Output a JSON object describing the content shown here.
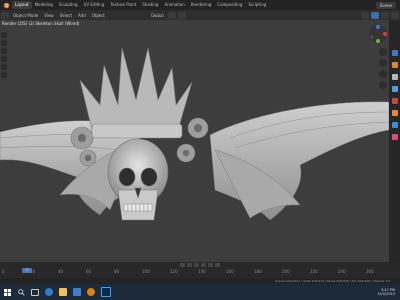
{
  "app": {
    "title_overlay": "Render (Z/S) (2) Skeleton Skull (Wired)",
    "workspace_tabs": [
      "Layout",
      "Modeling",
      "Sculpting",
      "UV Editing",
      "Texture Paint",
      "Shading",
      "Animation",
      "Rendering",
      "Compositing",
      "Scripting"
    ],
    "active_tab": "Layout",
    "scene": "Scene"
  },
  "header": {
    "items": [
      "Object Mode",
      "View",
      "Select",
      "Add",
      "Object"
    ],
    "transform": "Global"
  },
  "timeline": {
    "current_frame": "1",
    "ticks": [
      "0",
      "20",
      "40",
      "60",
      "80",
      "100",
      "120",
      "140",
      "160",
      "180",
      "200",
      "220",
      "240",
      "260"
    ]
  },
  "status": {
    "text": "Scene Collection | Verts 105,614 | Faces 209,848 | Tris 209,848 | Objects 1/3"
  },
  "taskbar": {
    "time": "3:47 PM",
    "date": "12/9/2019"
  },
  "colors": {
    "viewport": "#3d3d3d",
    "model": "#bdbdbd",
    "accent": "#4a76b8",
    "taskbar": "#1d2a38"
  },
  "icons": [
    "blender-logo-icon",
    "windows-start-icon",
    "search-icon",
    "task-view-icon",
    "edge-icon",
    "folder-icon",
    "store-icon",
    "blender-icon",
    "photoshop-icon"
  ]
}
